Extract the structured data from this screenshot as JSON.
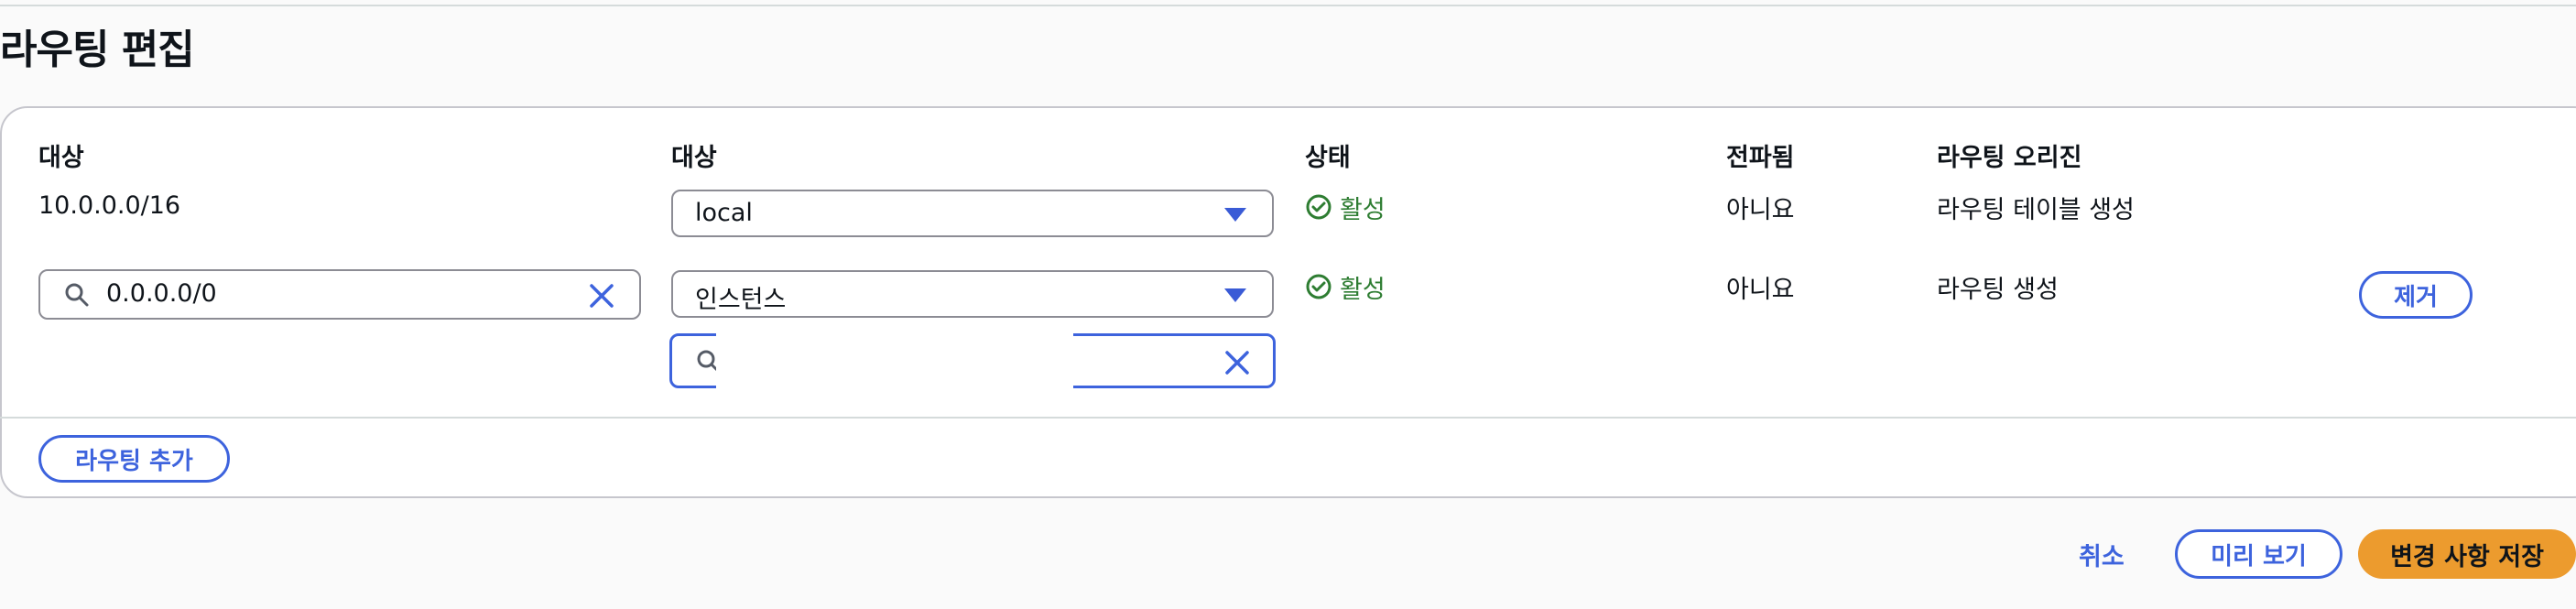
{
  "page": {
    "title": "라우팅 편집"
  },
  "table": {
    "headers": [
      "대상",
      "대상",
      "상태",
      "전파됨",
      "라우팅 오리진"
    ],
    "rows": [
      {
        "destination": "10.0.0.0/16",
        "target": "local",
        "status": "활성",
        "propagated": "아니요",
        "origin": "라우팅 테이블 생성"
      },
      {
        "destination": "0.0.0.0/0",
        "target": "인스턴스",
        "target_search_value": "",
        "status": "활성",
        "propagated": "아니요",
        "origin": "라우팅 생성",
        "remove_label": "제거"
      }
    ]
  },
  "actions": {
    "add_route": "라우팅 추가",
    "cancel": "취소",
    "preview": "미리 보기",
    "save": "변경 사항 저장"
  },
  "colors": {
    "accent": "#3d63dd",
    "status_ok": "#2e7d32",
    "primary": "#ec9b2e"
  },
  "icons": {
    "search": "search-icon",
    "clear": "close-icon",
    "status": "check-circle-icon",
    "dropdown": "caret-down-icon"
  }
}
